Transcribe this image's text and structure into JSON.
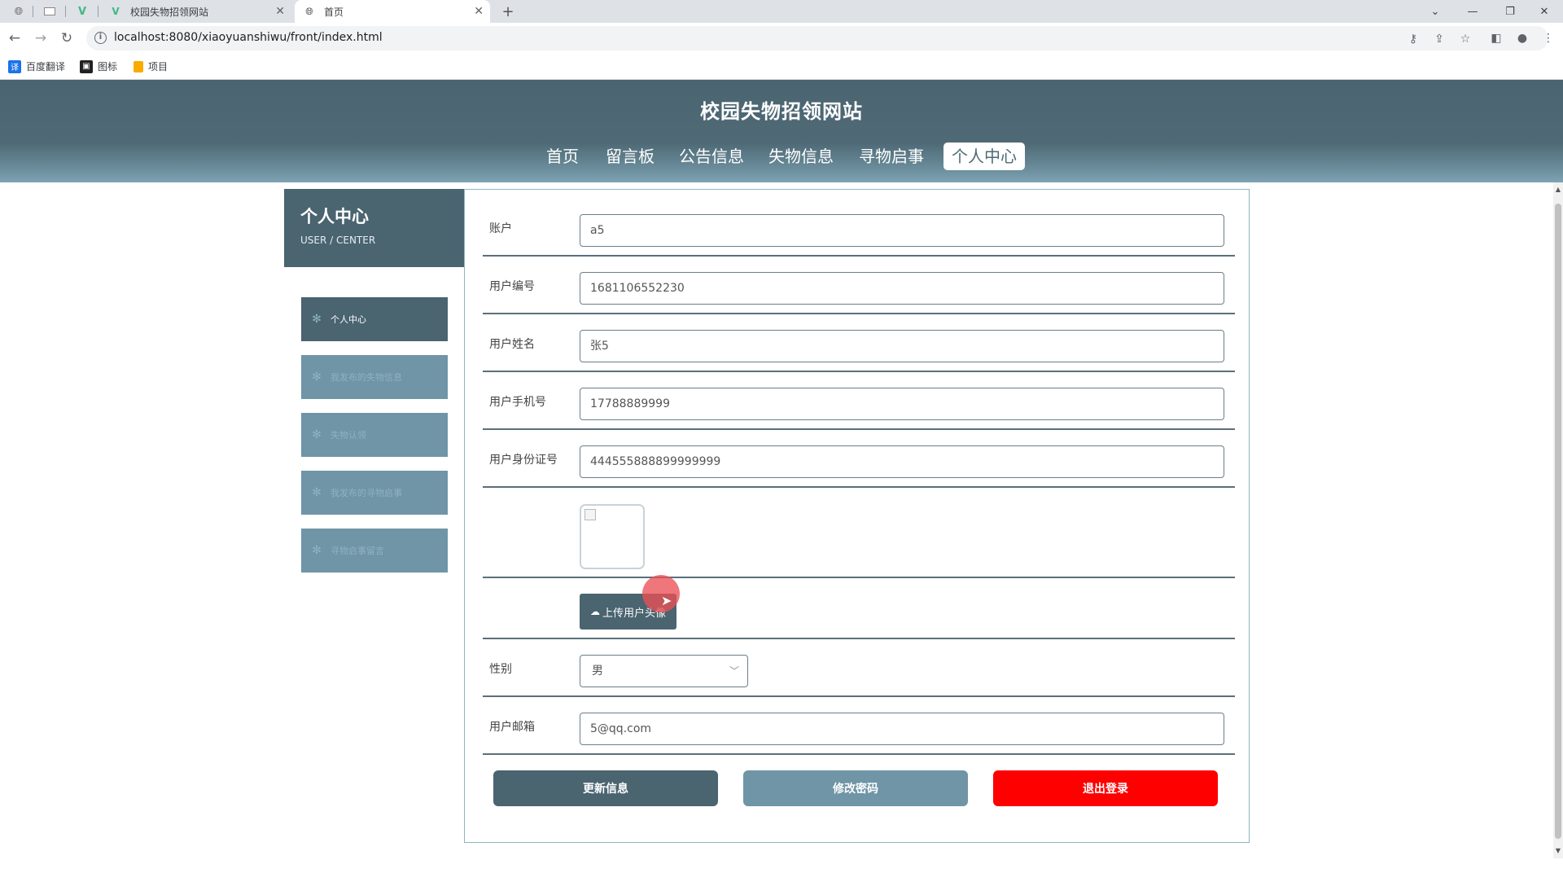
{
  "browser": {
    "tabs": [
      {
        "title": "校园失物招领网站",
        "icon": "vue-icon"
      },
      {
        "title": "首页",
        "icon": "globe-icon"
      }
    ],
    "url": "localhost:8080/xiaoyuanshiwu/front/index.html",
    "bookmarks": [
      {
        "label": "百度翻译",
        "icon": "translate-icon",
        "color": "#1a73e8"
      },
      {
        "label": "图标",
        "icon": "image-icon",
        "color": "#202124"
      },
      {
        "label": "项目",
        "icon": "folder-icon",
        "color": "#f9ab00"
      }
    ]
  },
  "site": {
    "title": "校园失物招领网站",
    "nav": [
      {
        "label": "首页"
      },
      {
        "label": "留言板"
      },
      {
        "label": "公告信息"
      },
      {
        "label": "失物信息"
      },
      {
        "label": "寻物启事"
      },
      {
        "label": "个人中心",
        "active": true
      }
    ]
  },
  "sidebar": {
    "title": "个人中心",
    "subtitle": "USER / CENTER",
    "items": [
      {
        "label": "个人中心",
        "active": true
      },
      {
        "label": "我发布的失物信息"
      },
      {
        "label": "失物认领"
      },
      {
        "label": "我发布的寻物启事"
      },
      {
        "label": "寻物启事留言"
      }
    ]
  },
  "form": {
    "fields": [
      {
        "label": "账户",
        "value": "a5"
      },
      {
        "label": "用户编号",
        "value": "1681106552230"
      },
      {
        "label": "用户姓名",
        "value": "张5"
      },
      {
        "label": "用户手机号",
        "value": "17788889999"
      },
      {
        "label": "用户身份证号",
        "value": "444555888899999999"
      }
    ],
    "upload_label": "上传用户头像",
    "gender": {
      "label": "性别",
      "value": "男"
    },
    "email": {
      "label": "用户邮箱",
      "value": "5@qq.com"
    },
    "buttons": {
      "update": "更新信息",
      "change_password": "修改密码",
      "logout": "退出登录"
    }
  },
  "colors": {
    "primary": "#4a6470",
    "secondary": "#6f95a6",
    "danger": "#ff0000"
  }
}
